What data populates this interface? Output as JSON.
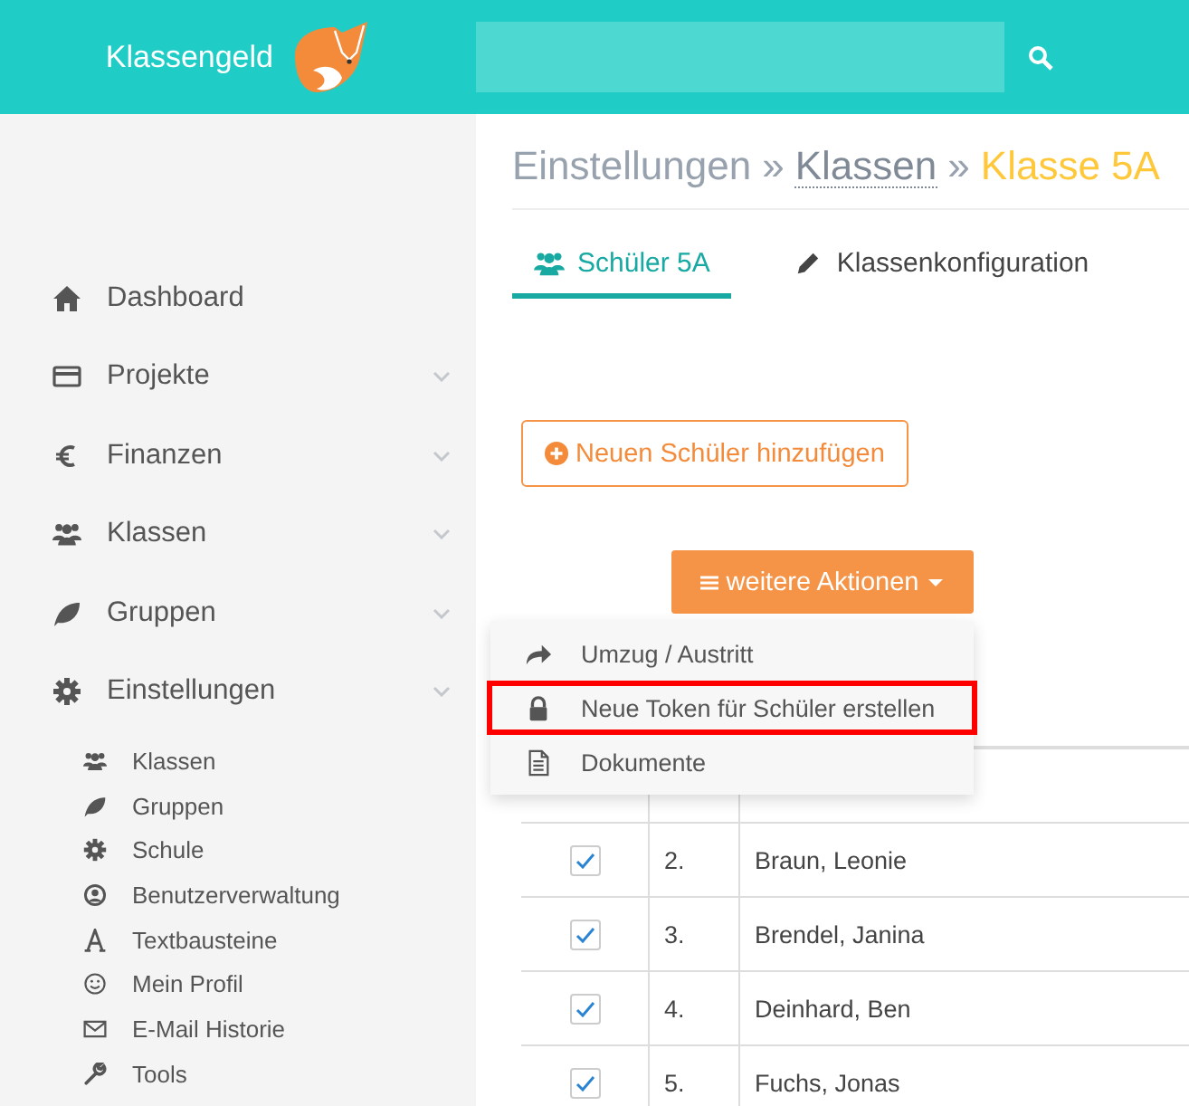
{
  "header": {
    "brand": "Klassengeld"
  },
  "sidebar": {
    "items": [
      {
        "label": "Dashboard",
        "expandable": false
      },
      {
        "label": "Projekte",
        "expandable": true
      },
      {
        "label": "Finanzen",
        "expandable": true
      },
      {
        "label": "Klassen",
        "expandable": true
      },
      {
        "label": "Gruppen",
        "expandable": true
      },
      {
        "label": "Einstellungen",
        "expandable": true,
        "children": [
          {
            "label": "Klassen"
          },
          {
            "label": "Gruppen"
          },
          {
            "label": "Schule"
          },
          {
            "label": "Benutzerverwaltung"
          },
          {
            "label": "Textbausteine"
          },
          {
            "label": "Mein Profil"
          },
          {
            "label": "E-Mail Historie"
          },
          {
            "label": "Tools"
          }
        ]
      }
    ]
  },
  "breadcrumb": [
    {
      "label": "Einstellungen",
      "kind": "plain"
    },
    {
      "label": "»",
      "kind": "sep"
    },
    {
      "label": "Klassen",
      "kind": "link"
    },
    {
      "label": "»",
      "kind": "sep"
    },
    {
      "label": "Klasse 5A",
      "kind": "current"
    }
  ],
  "tabs": [
    {
      "label": "Schüler 5A",
      "selected": true
    },
    {
      "label": "Klassenkonfiguration",
      "selected": false
    }
  ],
  "add_button": {
    "label": "Neuen Schüler hinzufügen"
  },
  "actions_button": {
    "label": "weitere Aktionen"
  },
  "actions_menu": [
    {
      "label": "Umzug / Austritt",
      "highlighted": false
    },
    {
      "label": "Neue Token für Schüler erstellen",
      "highlighted": true
    },
    {
      "label": "Dokumente",
      "highlighted": false
    }
  ],
  "table": {
    "rows": [
      {
        "checked": true,
        "number": "2.",
        "name": "Braun, Leonie"
      },
      {
        "checked": true,
        "number": "3.",
        "name": "Brendel, Janina"
      },
      {
        "checked": true,
        "number": "4.",
        "name": "Deinhard, Ben"
      },
      {
        "checked": true,
        "number": "5.",
        "name": "Fuchs, Jonas"
      }
    ]
  }
}
